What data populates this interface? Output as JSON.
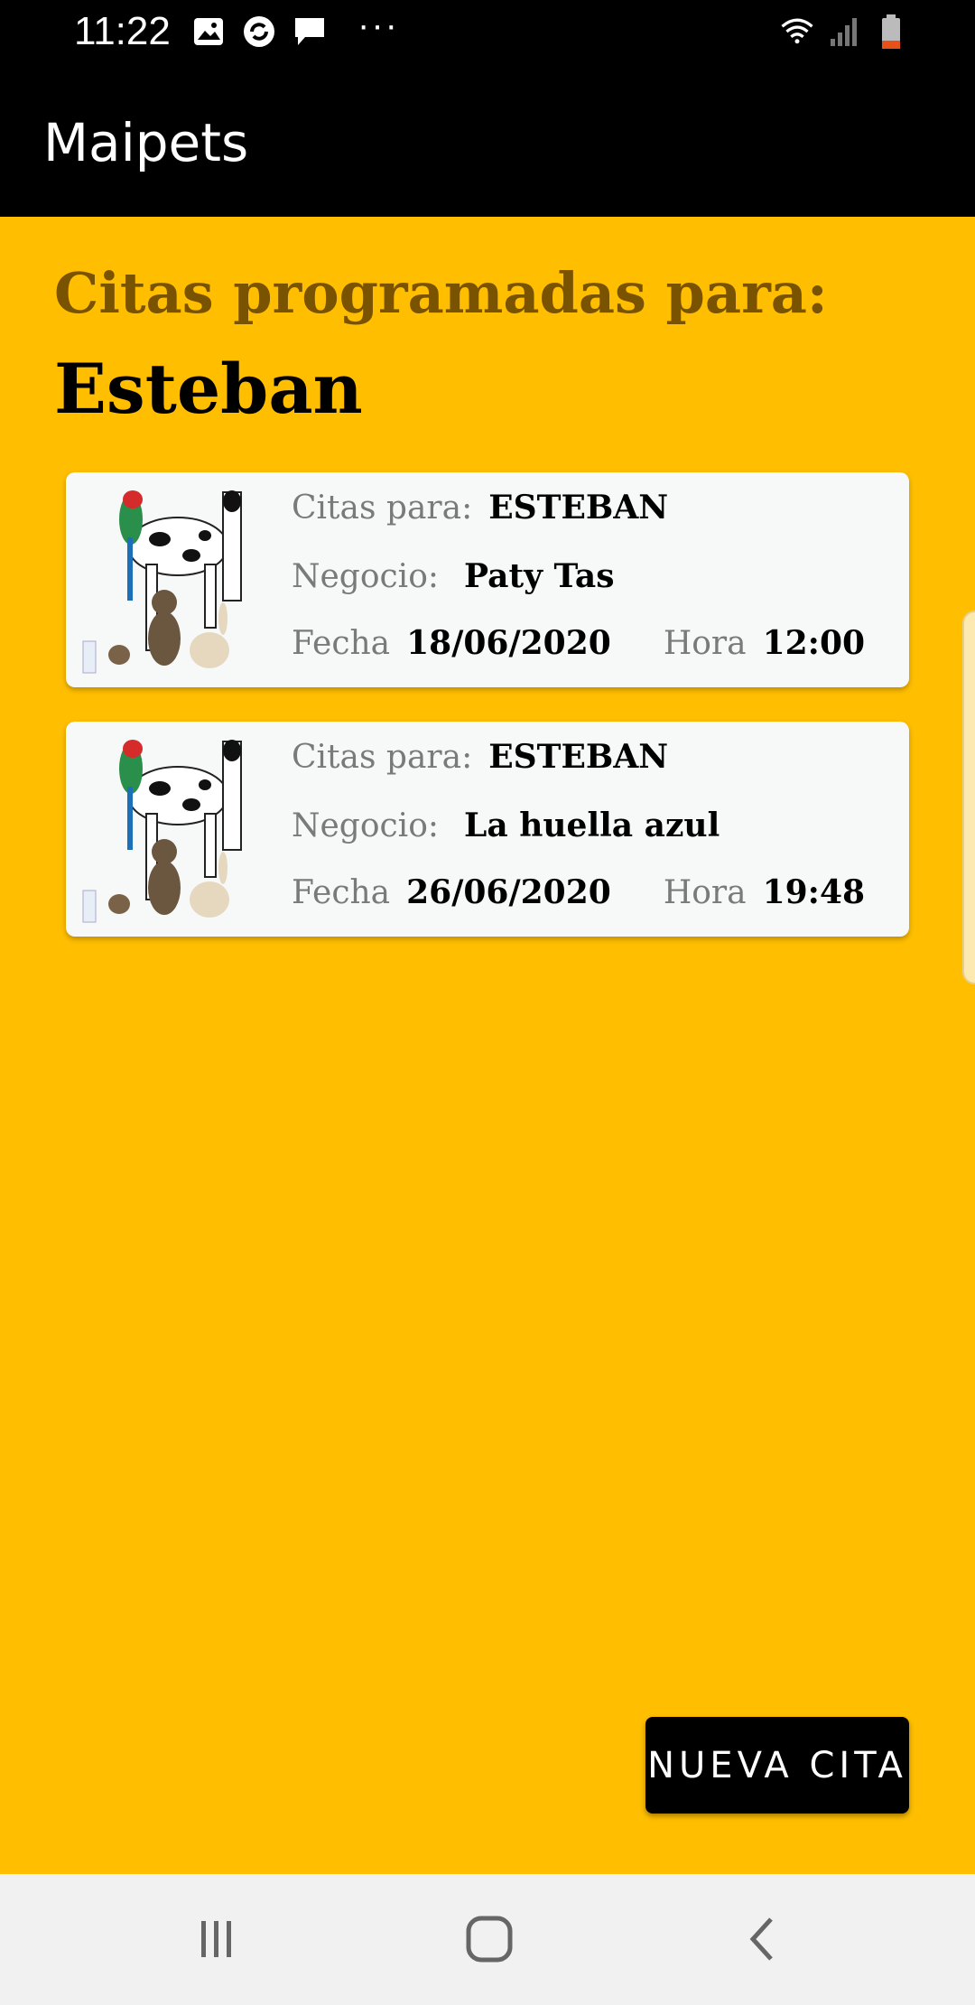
{
  "status_bar": {
    "time": "11:22",
    "left_icons": [
      "image-icon",
      "sync-icon",
      "message-icon"
    ],
    "more": "···",
    "right_icons": [
      "wifi-icon",
      "signal-icon",
      "battery-icon"
    ]
  },
  "app_bar": {
    "title": "Maipets"
  },
  "header": {
    "subtitle": "Citas programadas para:",
    "name": "Esteban"
  },
  "appointments": [
    {
      "image_icon": "pets-image",
      "citas_label": "Citas para:",
      "citas_value": "ESTEBAN",
      "negocio_label": "Negocio:",
      "negocio_value": "Paty Tas",
      "fecha_label": "Fecha",
      "fecha_value": "18/06/2020",
      "hora_label": "Hora",
      "hora_value": "12:00"
    },
    {
      "image_icon": "pets-image",
      "citas_label": "Citas para:",
      "citas_value": "ESTEBAN",
      "negocio_label": "Negocio:",
      "negocio_value": "La huella azul",
      "fecha_label": "Fecha",
      "fecha_value": "26/06/2020",
      "hora_label": "Hora",
      "hora_value": "19:48"
    }
  ],
  "fab": {
    "label": "NUEVA CITA"
  },
  "nav_bar": {
    "buttons": [
      "recents-icon",
      "home-icon",
      "back-icon"
    ]
  },
  "colors": {
    "background": "#FFBE00",
    "bar": "#000000",
    "card": "#F7F8F8",
    "subtitle": "#7A5300"
  }
}
